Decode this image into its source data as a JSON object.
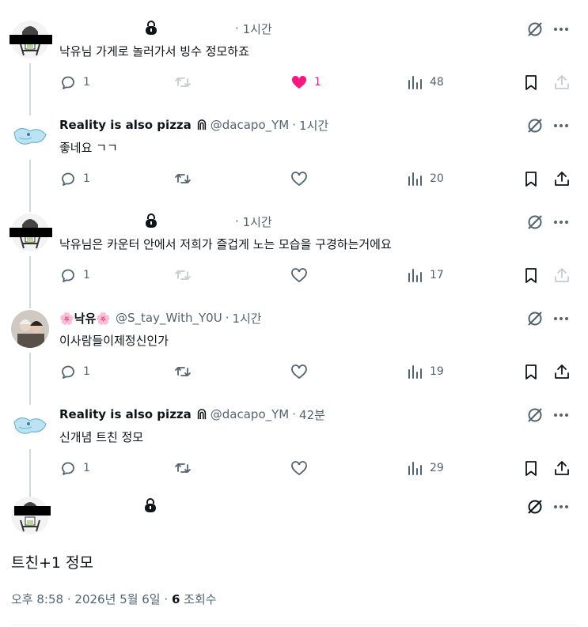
{
  "tweets": [
    {
      "name": "",
      "handle": "",
      "time": "1시간",
      "text": "낙유님 가게로 놀러가서 빙수 정모하죠",
      "avatar": "girl-doodle",
      "redacted": true,
      "locked": true,
      "replies": "1",
      "retweets": "",
      "likes": "1",
      "views": "48",
      "liked": true,
      "rt_disabled": true
    },
    {
      "name": "Reality is also pizza",
      "handle": "@dacapo_YM",
      "time": "1시간",
      "text": "좋네요 ㄱㄱ",
      "avatar": "blue-doodle",
      "redacted": false,
      "locked": false,
      "replies": "1",
      "retweets": "",
      "likes": "",
      "views": "20",
      "liked": false,
      "rt_disabled": false
    },
    {
      "name": "",
      "handle": "",
      "time": "1시간",
      "text": "낙유님은 카운터 안에서 저희가 즐겁게 노는 모습을 구경하는거에요",
      "avatar": "girl-doodle",
      "redacted": true,
      "locked": true,
      "replies": "1",
      "retweets": "",
      "likes": "",
      "views": "17",
      "liked": false,
      "rt_disabled": true
    },
    {
      "name": "🌸낙유🌸",
      "handle": "@S_tay_With_Y0U",
      "time": "1시간",
      "text": "이사람들이제정신인가",
      "avatar": "photo",
      "redacted": false,
      "locked": false,
      "replies": "1",
      "retweets": "",
      "likes": "",
      "views": "19",
      "liked": false,
      "rt_disabled": false
    },
    {
      "name": "Reality is also pizza",
      "handle": "@dacapo_YM",
      "time": "42분",
      "text": "신개념 트친 정모",
      "avatar": "blue-doodle",
      "redacted": false,
      "locked": false,
      "replies": "1",
      "retweets": "",
      "likes": "",
      "views": "29",
      "liked": false,
      "rt_disabled": false
    }
  ],
  "main": {
    "text": "트친+1 정모",
    "time": "오후 8:58",
    "date": "2026년 5월 6일",
    "views_count": "6",
    "views_label": "조회수",
    "separator": "·"
  },
  "colors": {
    "like_pink": "#f91880",
    "muted": "#536471",
    "line": "#cfd9de"
  },
  "icons": [
    "lock-icon",
    "reply-icon",
    "retweet-icon",
    "like-icon",
    "views-icon",
    "bookmark-icon",
    "share-icon",
    "grok-icon",
    "more-icon"
  ]
}
